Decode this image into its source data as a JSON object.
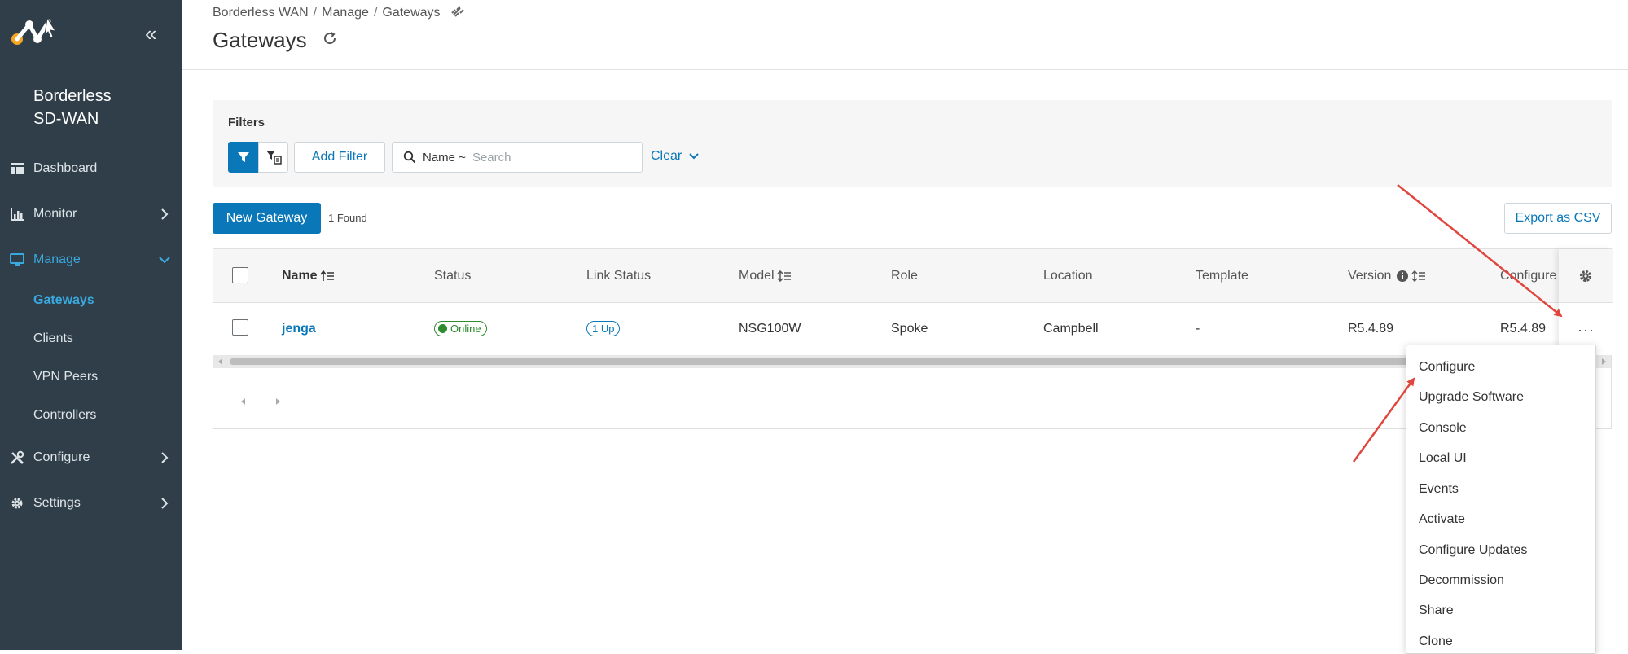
{
  "sidebar": {
    "brand_line1": "Borderless",
    "brand_line2": "SD-WAN",
    "items": [
      {
        "label": "Dashboard",
        "icon": "dashboard-icon"
      },
      {
        "label": "Monitor",
        "icon": "chart-icon"
      },
      {
        "label": "Manage",
        "icon": "monitor-icon"
      },
      {
        "label": "Configure",
        "icon": "tools-icon"
      },
      {
        "label": "Settings",
        "icon": "gear-icon"
      }
    ],
    "manage_subitems": [
      "Gateways",
      "Clients",
      "VPN Peers",
      "Controllers"
    ],
    "active_color": "#3aa9e0",
    "background": "#2f3e48"
  },
  "header": {
    "breadcrumb": [
      "Borderless WAN",
      "Manage",
      "Gateways"
    ],
    "title": "Gateways"
  },
  "filters": {
    "title": "Filters",
    "add_filter_label": "Add Filter",
    "search_prefix": "Name ~",
    "search_placeholder": "Search",
    "clear_label": "Clear"
  },
  "toolbar": {
    "new_button_label": "New Gateway",
    "found_text": "1 Found",
    "export_label": "Export as CSV"
  },
  "table": {
    "columns": [
      "Name",
      "Status",
      "Link Status",
      "Model",
      "Role",
      "Location",
      "Template",
      "Version",
      "Configure"
    ],
    "rows": [
      {
        "name": "jenga",
        "status": "Online",
        "link_status": "1 Up",
        "model": "NSG100W",
        "role": "Spoke",
        "location": "Campbell",
        "template": "-",
        "version": "R5.4.89",
        "configure": "R5.4.89"
      }
    ]
  },
  "row_menu": {
    "items": [
      "Configure",
      "Upgrade Software",
      "Console",
      "Local UI",
      "Events",
      "Activate",
      "Configure Updates",
      "Decommission",
      "Share",
      "Clone"
    ]
  },
  "colors": {
    "accent": "#0a77b8",
    "online": "#2e8b2e",
    "annotation_arrow": "#e0463e"
  }
}
